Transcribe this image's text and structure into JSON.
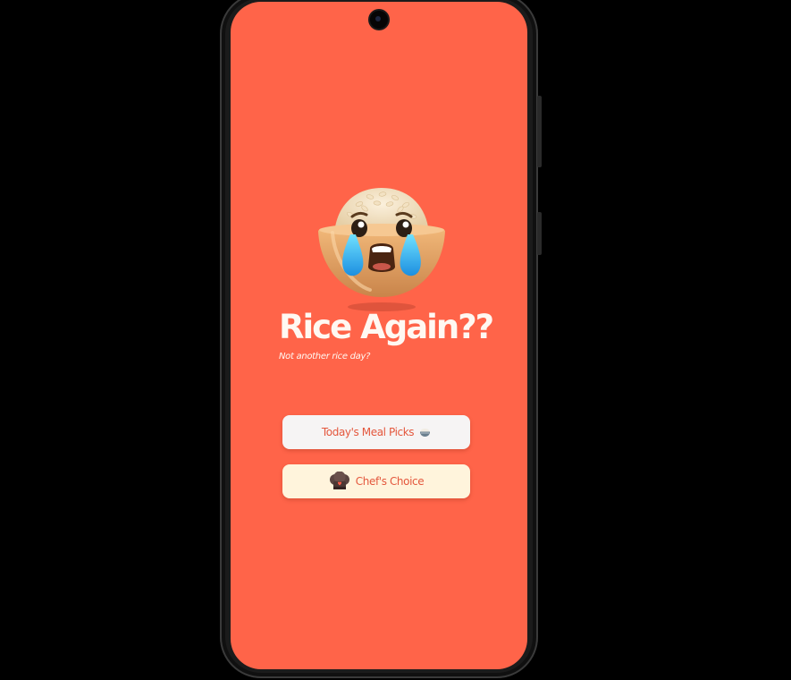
{
  "screen": {
    "title": "Rice Again??",
    "subtitle": "Not another rice day?",
    "mascot_icon": "crying-rice-bowl-icon",
    "background_color": "#ff6449"
  },
  "buttons": {
    "meal_picks": {
      "label": "Today's Meal Picks",
      "icon": "rice-bowl-icon",
      "background": "#f6f4f4"
    },
    "chefs_choice": {
      "label": "Chef's Choice",
      "icon": "chef-hat-icon",
      "background": "#fff4dc"
    }
  },
  "accent_color": "#e4573d"
}
